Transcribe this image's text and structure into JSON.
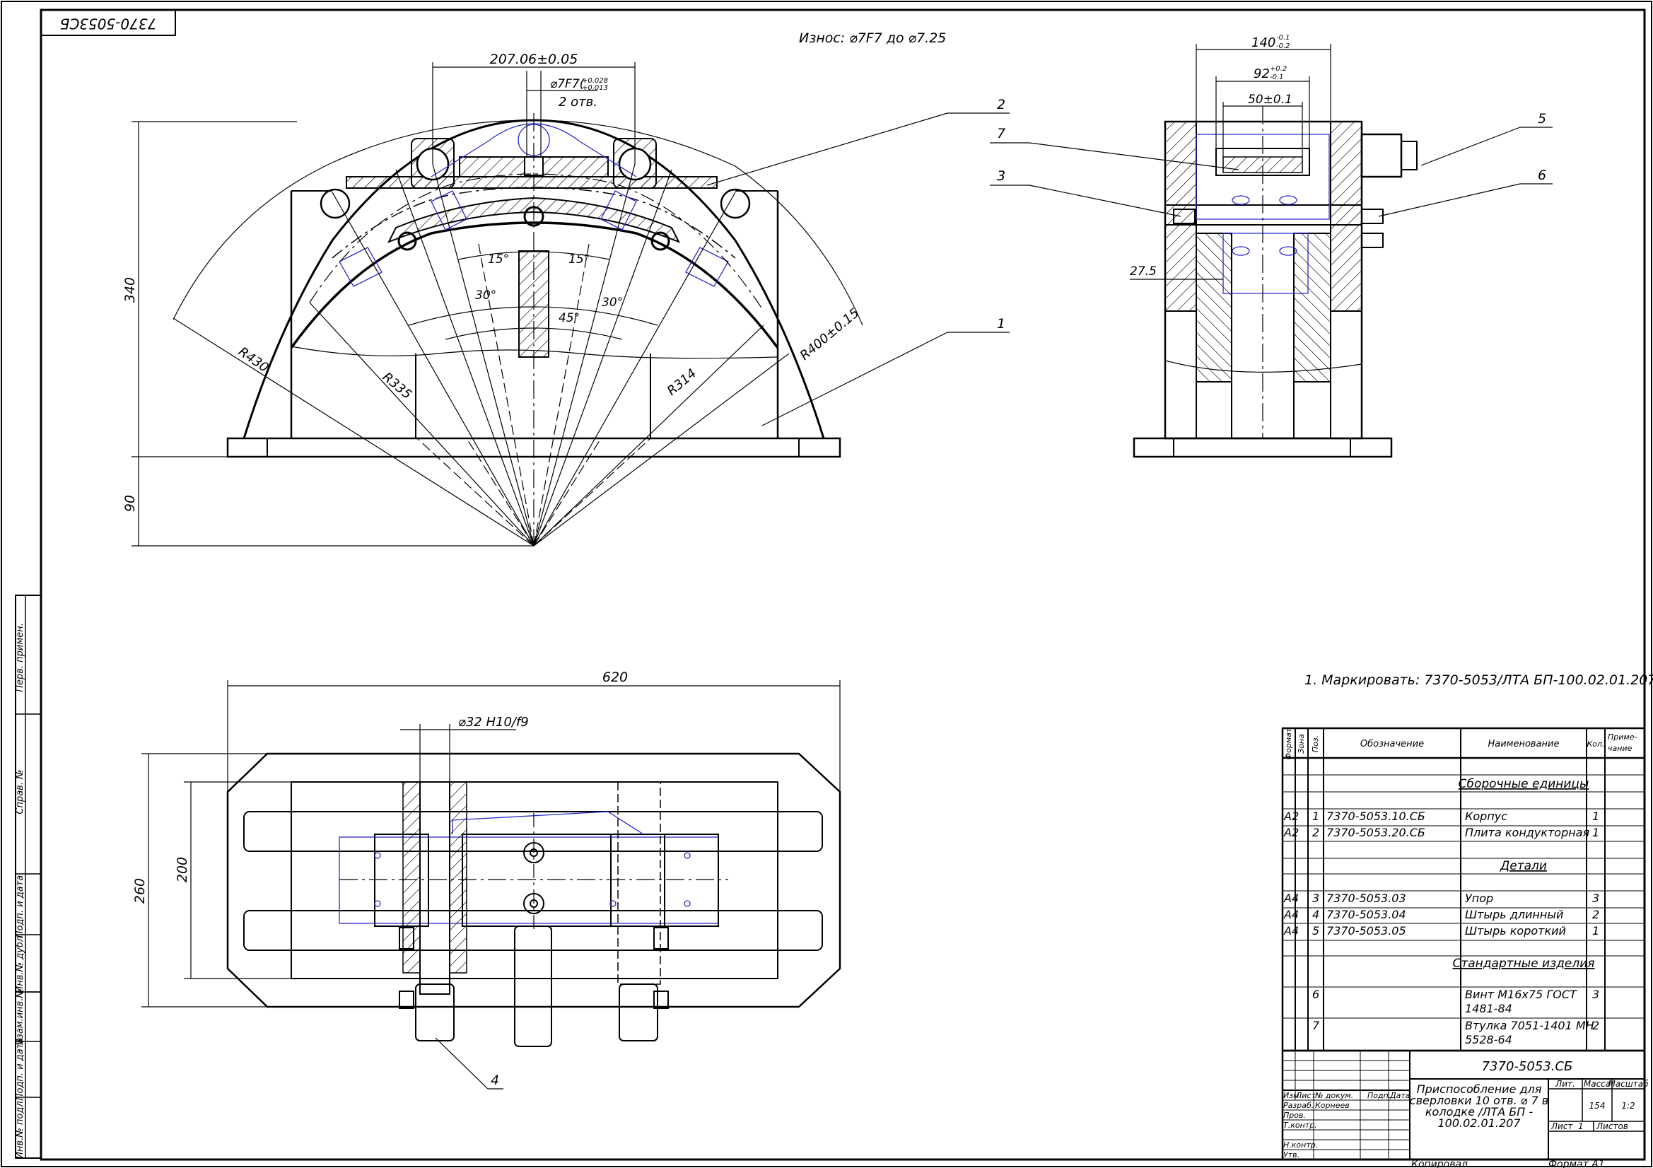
{
  "drawing": {
    "top_stamp": "7370-5053СБ",
    "wear_note": "Износ:  ⌀7F7 до ⌀7.25",
    "marking_note": "1. Маркировать: 7370-5053/ЛТА БП-100.02.01.207.",
    "copied_label": "Копировал",
    "format_label": "Формат  А1"
  },
  "front_view": {
    "dim_top": "207.06±0.05",
    "dim_hole_main": "⌀7F7(",
    "dim_hole_tol_up": "+0.028",
    "dim_hole_tol_dn": "+0.013",
    "dim_hole_count": "2 отв.",
    "dim_height": "340",
    "dim_base": "90",
    "angle_15_left": "15°",
    "angle_15_right": "15°",
    "angle_30_left": "30°",
    "angle_30_right": "30°",
    "angle_45": "45°",
    "r430": "R430",
    "r335": "R335",
    "r314": "R314",
    "r400": "R400±0.15"
  },
  "side_view": {
    "dim_140": "140",
    "dim_140_up": "-0.1",
    "dim_140_dn": "-0.2",
    "dim_92": "92",
    "dim_92_up": "+0.2",
    "dim_92_dn": "-0.1",
    "dim_50": "50±0.1",
    "dim_27": "27.5"
  },
  "plan_view": {
    "dim_620": "620",
    "dim_pin": "⌀32 H10/f9",
    "dim_260": "260",
    "dim_200": "200"
  },
  "callouts": [
    "1",
    "2",
    "3",
    "4",
    "5",
    "6",
    "7"
  ],
  "left_strip": [
    "Перв. примен.",
    "Справ. №",
    "Подп. и дата",
    "Инв.№ дубл.",
    "Взам.инв.№",
    "Подп. и дата",
    "Инв.№ подл."
  ],
  "spec_table": {
    "headers": {
      "format": "Формат",
      "zone": "Зона",
      "pos": "Поз.",
      "designation": "Обозначение",
      "name": "Наименование",
      "qty": "Кол.",
      "note1": "Приме-",
      "note2": "чание"
    },
    "sections": {
      "assemblies": "Сборочные единицы",
      "parts": "Детали",
      "standard": "Стандартные изделия"
    },
    "rows": [
      {
        "format": "A2",
        "pos": "1",
        "designation": "7370-5053.10.СБ",
        "name": "Корпус",
        "qty": "1"
      },
      {
        "format": "A2",
        "pos": "2",
        "designation": "7370-5053.20.СБ",
        "name": "Плита кондукторная",
        "qty": "1"
      },
      {
        "format": "A4",
        "pos": "3",
        "designation": "7370-5053.03",
        "name": "Упор",
        "qty": "3"
      },
      {
        "format": "A4",
        "pos": "4",
        "designation": "7370-5053.04",
        "name": "Штырь длинный",
        "qty": "2"
      },
      {
        "format": "A4",
        "pos": "5",
        "designation": "7370-5053.05",
        "name": "Штырь короткий",
        "qty": "1"
      },
      {
        "format": "",
        "pos": "6",
        "designation": "",
        "name1": "Винт М16х75 ГОСТ",
        "name2": "1481-84",
        "qty": "3"
      },
      {
        "format": "",
        "pos": "7",
        "designation": "",
        "name1": "Втулка 7051-1401 МН",
        "name2": "5528-64",
        "qty": "2"
      }
    ]
  },
  "title_block": {
    "doc_code": "7370-5053.СБ",
    "title_lines": [
      "Приспособление для",
      "сверловки 10 отв. ⌀ 7 в",
      "колодке /ЛТА БП -",
      "100.02.01.207"
    ],
    "col_izm": "Изм.",
    "col_list": "Лист",
    "col_doc": "№ докум.",
    "col_podp": "Подп.",
    "col_date": "Дата",
    "row_razrab": "Разраб.",
    "razrab_name": "Корнеев",
    "row_prov": "Пров.",
    "row_tkontr": "Т.контр.",
    "row_nkontr": "Н.контр.",
    "row_utv": "Утв.",
    "lit": "Лит.",
    "mass": "Масса",
    "scale": "Масштаб",
    "mass_value": "154",
    "scale_value": "1:2",
    "sheet": "Лист",
    "sheet_num": "1",
    "sheets": "Листов"
  }
}
